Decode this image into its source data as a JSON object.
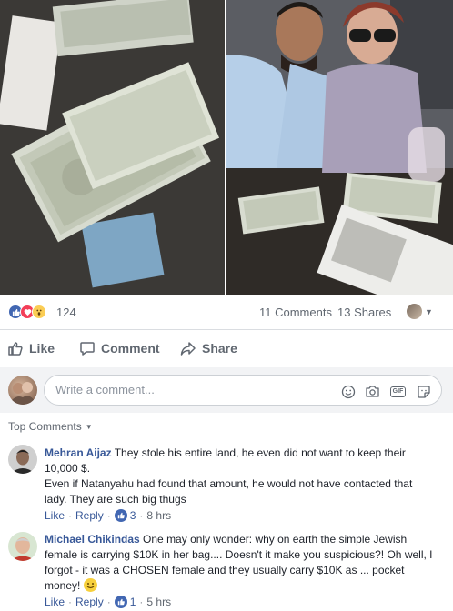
{
  "post": {
    "reactions": {
      "count": "124",
      "types": [
        "like-icon",
        "love-icon",
        "wow-icon"
      ]
    },
    "comments_count": "11 Comments",
    "shares_count": "13 Shares"
  },
  "actions": {
    "like": "Like",
    "comment": "Comment",
    "share": "Share"
  },
  "composer": {
    "placeholder": "Write a comment..."
  },
  "top_comments_label": "Top Comments",
  "comments": [
    {
      "author": "Mehran Aijaz",
      "text": "They stole his entire land, he even did not want to keep their 10,000 $.",
      "text2": "Even if Natanyahu had found that amount, he would not have contacted that lady. They are such big thugs",
      "like_label": "Like",
      "reply_label": "Reply",
      "likes": "3",
      "time": "8 hrs"
    },
    {
      "author": "Michael Chikindas",
      "text": "One may only wonder: why on earth the simple Jewish female is carrying $10K in her bag.... Doesn't it make you suspicious?! Oh well, I forgot - it was a CHOSEN female and they usually carry $10K as ... pocket money!",
      "like_label": "Like",
      "reply_label": "Reply",
      "likes": "1",
      "time": "5 hrs"
    }
  ],
  "colors": {
    "link": "#385898",
    "like_blue": "#4267b2",
    "love_red": "#f33e58",
    "wow_yellow": "#fbcd55"
  }
}
